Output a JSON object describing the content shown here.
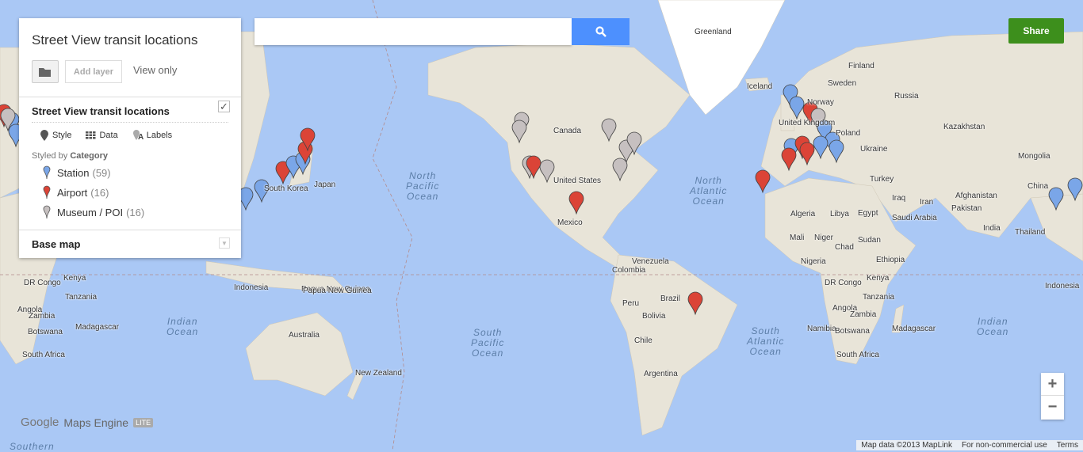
{
  "panel": {
    "title": "Street View transit locations",
    "add_layer": "Add layer",
    "view_only": "View only",
    "layer": {
      "title": "Street View transit locations",
      "checked": true,
      "tools": {
        "style": "Style",
        "data": "Data",
        "labels": "Labels"
      },
      "styled_by_prefix": "Styled by",
      "styled_by": "Category",
      "categories": [
        {
          "label": "Station",
          "count": "(59)",
          "color": "#7aa6e8"
        },
        {
          "label": "Airport",
          "count": "(16)",
          "color": "#db4437"
        },
        {
          "label": "Museum / POI",
          "count": "(16)",
          "color": "#c6c0c0"
        }
      ]
    },
    "base_map": "Base map"
  },
  "search": {
    "placeholder": "",
    "value": ""
  },
  "share": "Share",
  "zoom": {
    "in": "+",
    "out": "−"
  },
  "logo": {
    "google": "Google",
    "product": "Maps Engine",
    "badge": "LITE"
  },
  "attribution": {
    "data": "Map data ©2013 MapLink",
    "use": "For non-commercial use",
    "terms": "Terms"
  },
  "map": {
    "oceans": [
      "North\nPacific\nOcean",
      "North\nAtlantic\nOcean",
      "South\nPacific\nOcean",
      "South\nAtlantic\nOcean",
      "Indian\nOcean",
      "Indian\nOcean",
      "Southern"
    ],
    "labels": [
      "Greenland",
      "Iceland",
      "Norway",
      "Sweden",
      "Finland",
      "Russia",
      "United Kingdom",
      "Poland",
      "Ukraine",
      "Kazakhstan",
      "Mongolia",
      "China",
      "Turkey",
      "Iraq",
      "Iran",
      "Afghanistan",
      "Pakistan",
      "India",
      "Thailand",
      "Indonesia",
      "Algeria",
      "Libya",
      "Egypt",
      "Saudi Arabia",
      "Mali",
      "Niger",
      "Chad",
      "Sudan",
      "Ethiopia",
      "Nigeria",
      "DR Congo",
      "Kenya",
      "Tanzania",
      "Angola",
      "Zambia",
      "Namibia",
      "Botswana",
      "South Africa",
      "Madagascar",
      "Canada",
      "United States",
      "Mexico",
      "Venezuela",
      "Colombia",
      "Peru",
      "Brazil",
      "Bolivia",
      "Chile",
      "Argentina",
      "Australia",
      "Papua New Guinea",
      "New Zealand",
      "South Korea",
      "Japan",
      "DR Congo",
      "Kenya",
      "Tanzania",
      "Angola",
      "Zambia",
      "Botswana",
      "Madagascar",
      "South Africa",
      "Indonesia",
      "Papua New Guinea"
    ],
    "colors": {
      "ocean": "#aac8f5",
      "land": "#e8e4d8",
      "green": "#cfe0b4",
      "ice": "#ffffff"
    }
  }
}
